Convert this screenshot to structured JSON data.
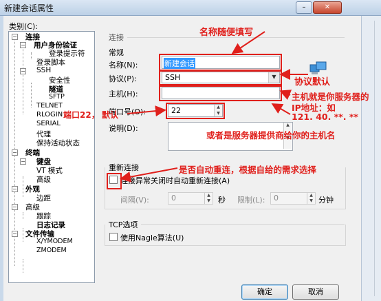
{
  "window": {
    "title": "新建会话属性",
    "min_label": "–",
    "close_label": "✕"
  },
  "category_label": "类别(C):",
  "tree": [
    {
      "label": "连接",
      "bold": true
    },
    {
      "label": "用户身份验证",
      "bold": true
    },
    {
      "label": "登录提示符"
    },
    {
      "label": "登录脚本"
    },
    {
      "label": "SSH"
    },
    {
      "label": "安全性"
    },
    {
      "label": "隧道",
      "bold": true
    },
    {
      "label": "SFTP"
    },
    {
      "label": "TELNET"
    },
    {
      "label": "RLOGIN"
    },
    {
      "label": "SERIAL"
    },
    {
      "label": "代理"
    },
    {
      "label": "保持活动状态"
    },
    {
      "label": "终端",
      "bold": true
    },
    {
      "label": "键盘",
      "bold": true
    },
    {
      "label": "VT 模式"
    },
    {
      "label": "高级"
    },
    {
      "label": "外观",
      "bold": true
    },
    {
      "label": "边距"
    },
    {
      "label": "高级"
    },
    {
      "label": "跟踪"
    },
    {
      "label": "日志记录",
      "bold": true
    },
    {
      "label": "文件传输",
      "bold": true
    },
    {
      "label": "X/YMODEM"
    },
    {
      "label": "ZMODEM"
    }
  ],
  "panel": {
    "section_title": "连接",
    "general_title": "常规",
    "name_label": "名称(N):",
    "name_value": "新建会话",
    "protocol_label": "协议(P):",
    "protocol_value": "SSH",
    "host_label": "主机(H):",
    "host_value": "",
    "port_label": "端口号(O):",
    "port_value": "22",
    "desc_label": "说明(D):",
    "reconnect_title": "重新连接",
    "reconnect_check_label": "连接异常关闭时自动重新连接(A)",
    "interval_label": "间隔(V):",
    "interval_value": "0",
    "interval_unit": "秒",
    "limit_label": "限制(L):",
    "limit_value": "0",
    "limit_unit": "分钟",
    "tcp_title": "TCP选项",
    "nagle_label": "使用Nagle算法(U)"
  },
  "buttons": {
    "ok": "确定",
    "cancel": "取消"
  },
  "annotations": {
    "name_note": "名称随便填写",
    "protocol_note": "协议默认",
    "host_note_1": "主机就是你服务器的",
    "host_note_2": "IP地址：如",
    "host_note_3": "121. 40. **. **",
    "host_note_4": "或者是服务器提供商给你的主机名",
    "port_note_1": "端口22，",
    "port_note_2": "默认",
    "reconnect_note": "是否自动重连，根据自给的需求选择"
  },
  "colors": {
    "annotation_red": "#e0201c",
    "title_bar": "#c9d9ea"
  }
}
